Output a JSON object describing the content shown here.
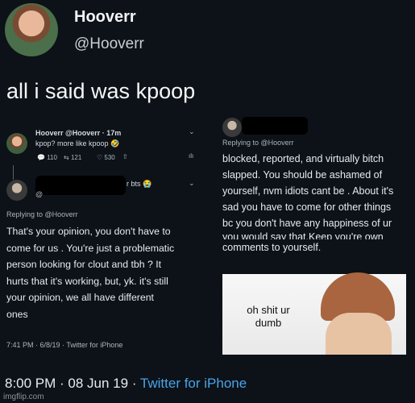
{
  "main_tweet": {
    "display_name": "Hooverr",
    "handle": "@Hooverr",
    "text": "all i said was kpoop",
    "timestamp": "8:00 PM",
    "date": "08 Jun 19",
    "source": "Twitter for iPhone",
    "separator": " · "
  },
  "left_tweet": {
    "header": "Hooverr @Hooverr · 17m",
    "text": "kpop? more like kpoop 🤣",
    "stats": {
      "replies": "110",
      "retweets": "121",
      "likes": "530"
    },
    "reply_name_suffix": "r bts 😭",
    "reply_handle_prefix": "@",
    "replying_to": "Replying to @Hooverr",
    "reply_lines": [
      "That's your opinion, you don't have to",
      "come for us . You're just a problematic",
      "person looking for clout and tbh ? It",
      "hurts that it's working, but, yk. it's still",
      "your opinion, we all have different",
      "ones"
    ],
    "reply_meta": "7:41 PM · 6/8/19 · Twitter for iPhone"
  },
  "right_tweet": {
    "replying_to": "Replying to @Hooverr",
    "lines": [
      "blocked, reported, and virtually bitch",
      "slapped. You should be ashamed of",
      "yourself, nvm idiots cant be . About it's",
      "sad you have to come for other things",
      "bc you don't have any happiness of ur",
      "you would say that.Keep you're own",
      "comments to yourself."
    ],
    "meme_caption_1": "oh shit ur",
    "meme_caption_2": "dumb"
  },
  "watermark": "imgflip.com"
}
